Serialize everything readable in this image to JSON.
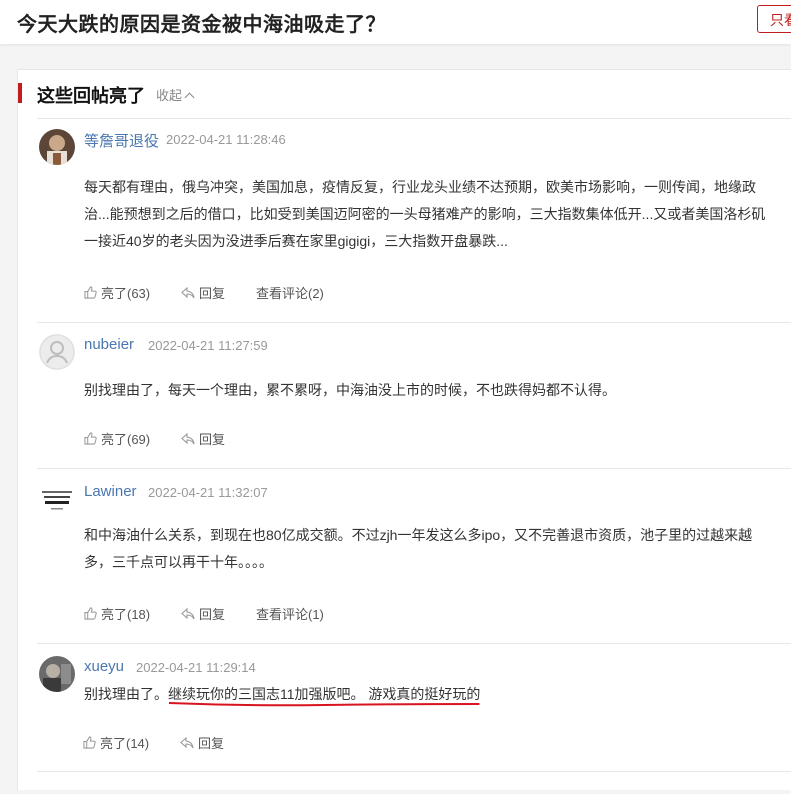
{
  "header": {
    "title": "今天大跌的原因是资金被中海油吸走了？",
    "only_label": "只看"
  },
  "panel": {
    "title": "这些回帖亮了",
    "collapse_label": "收起"
  },
  "replies": [
    {
      "username": "等詹哥退役",
      "time": "2022-04-21 11:28:46",
      "content": "每天都有理由，俄乌冲突，美国加息，疫情反复，行业龙头业绩不达预期，欧美市场影响，一则传闻，地缘政治...能预想到之后的借口，比如受到美国迈阿密的一头母猪难产的影响，三大指数集体低开...又或者美国洛杉矶一接近40岁的老头因为没进季后赛在家里gigigi，三大指数开盘暴跌...",
      "like_label": "亮了(63)",
      "reply_label": "回复",
      "comments_label": "查看评论(2)",
      "more": "点"
    },
    {
      "username": "nubeier",
      "time": "2022-04-21 11:27:59",
      "content": "别找理由了，每天一个理由，累不累呀，中海油没上市的时候，不也跌得妈都不认得。",
      "like_label": "亮了(69)",
      "reply_label": "回复",
      "more": "点"
    },
    {
      "username": "Lawiner",
      "time": "2022-04-21 11:32:07",
      "content": "和中海油什么关系，到现在也80亿成交额。不过zjh一年发这么多ipo，又不完善退市资质，池子里的过越来越多，三千点可以再干十年。。。。",
      "like_label": "亮了(18)",
      "reply_label": "回复",
      "comments_label": "查看评论(1)",
      "more": "点"
    },
    {
      "username": "xueyu",
      "time": "2022-04-21 11:29:14",
      "content_prefix": "别找理由了。",
      "content_highlight": "继续玩你的三国志11加强版吧。 游戏真的挺好玩的",
      "like_label": "亮了(14)",
      "reply_label": "回复",
      "more": "点"
    }
  ],
  "colors": {
    "accent_red": "#c01e1e",
    "username_blue": "#4a77b0",
    "meta_gray": "#999999"
  }
}
